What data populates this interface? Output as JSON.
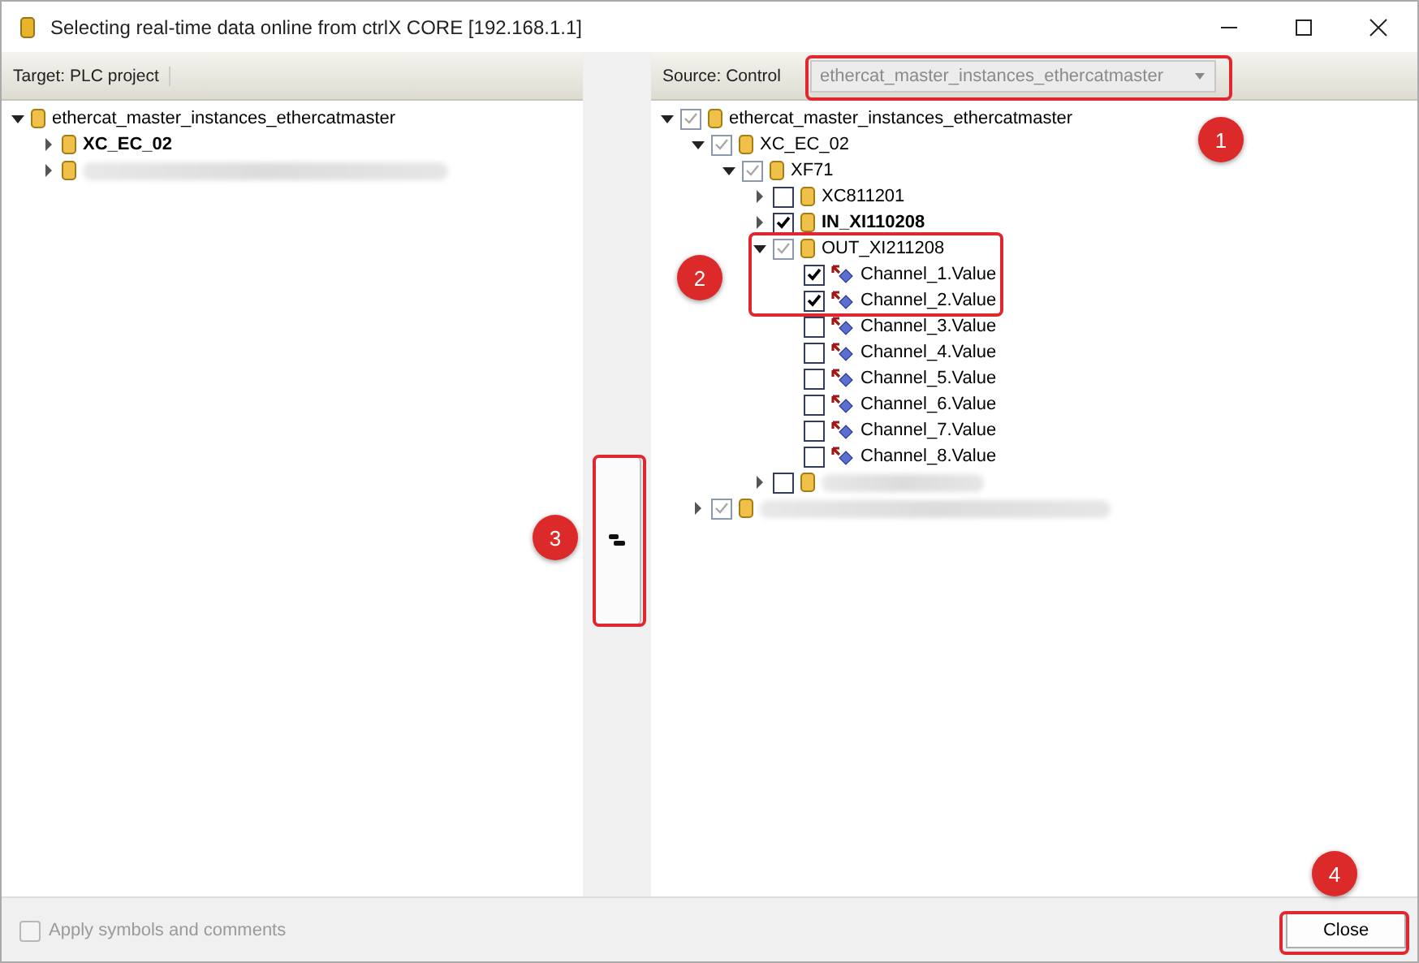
{
  "window": {
    "title": "Selecting real-time data online from ctrlX CORE [192.168.1.1]"
  },
  "target_panel": {
    "header": "Target: PLC project",
    "tree": [
      {
        "kind": "folder",
        "label": "ethercat_master_instances_ethercatmaster",
        "bold": false,
        "expanded": true,
        "children": [
          {
            "kind": "folder",
            "label": "XC_EC_02",
            "bold": true,
            "expanded": false
          },
          {
            "kind": "blurred",
            "expanded": false
          }
        ]
      }
    ]
  },
  "source_panel": {
    "header": "Source: Control",
    "combobox": {
      "value": "ethercat_master_instances_ethercatmaster",
      "disabled": true,
      "highlighted": true
    },
    "tree": [
      {
        "kind": "folder",
        "label": "ethercat_master_instances_ethercatmaster",
        "bold": false,
        "expanded": true,
        "checked": true,
        "greyed": true,
        "children": [
          {
            "kind": "folder",
            "label": "XC_EC_02",
            "bold": false,
            "expanded": true,
            "checked": true,
            "greyed": true,
            "children": [
              {
                "kind": "folder",
                "label": "XF71",
                "bold": false,
                "expanded": true,
                "checked": true,
                "greyed": true,
                "children": [
                  {
                    "kind": "folder",
                    "label": "XC811201",
                    "bold": false,
                    "expanded": false,
                    "checked": false
                  },
                  {
                    "kind": "folder",
                    "label": "IN_XI110208",
                    "bold": true,
                    "expanded": false,
                    "checked": true,
                    "greyed": false
                  },
                  {
                    "kind": "folder",
                    "label": "OUT_XI211208",
                    "bold": false,
                    "expanded": true,
                    "checked": true,
                    "greyed": true,
                    "highlighted": true,
                    "children": [
                      {
                        "kind": "variable",
                        "label": "Channel_1.Value",
                        "bold": false,
                        "checked": true,
                        "greyed": false
                      },
                      {
                        "kind": "variable",
                        "label": "Channel_2.Value",
                        "bold": false,
                        "checked": true,
                        "greyed": false
                      },
                      {
                        "kind": "variable",
                        "label": "Channel_3.Value",
                        "bold": false,
                        "checked": false
                      },
                      {
                        "kind": "variable",
                        "label": "Channel_4.Value",
                        "bold": false,
                        "checked": false
                      },
                      {
                        "kind": "variable",
                        "label": "Channel_5.Value",
                        "bold": false,
                        "checked": false
                      },
                      {
                        "kind": "variable",
                        "label": "Channel_6.Value",
                        "bold": false,
                        "checked": false
                      },
                      {
                        "kind": "variable",
                        "label": "Channel_7.Value",
                        "bold": false,
                        "checked": false
                      },
                      {
                        "kind": "variable",
                        "label": "Channel_8.Value",
                        "bold": false,
                        "checked": false
                      }
                    ]
                  },
                  {
                    "kind": "blurred",
                    "expanded": false,
                    "checked": false
                  }
                ]
              }
            ]
          },
          {
            "kind": "blurred",
            "expanded": false,
            "checked": true,
            "greyed": true
          }
        ]
      }
    ]
  },
  "transfer_button": {
    "highlighted": true
  },
  "apply_checkbox": {
    "label": "Apply symbols and comments",
    "checked": false,
    "disabled": true
  },
  "close_button": {
    "label": "Close",
    "highlighted": true
  },
  "annotations": [
    {
      "text": "1"
    },
    {
      "text": "2"
    },
    {
      "text": "3"
    },
    {
      "text": "4"
    }
  ]
}
